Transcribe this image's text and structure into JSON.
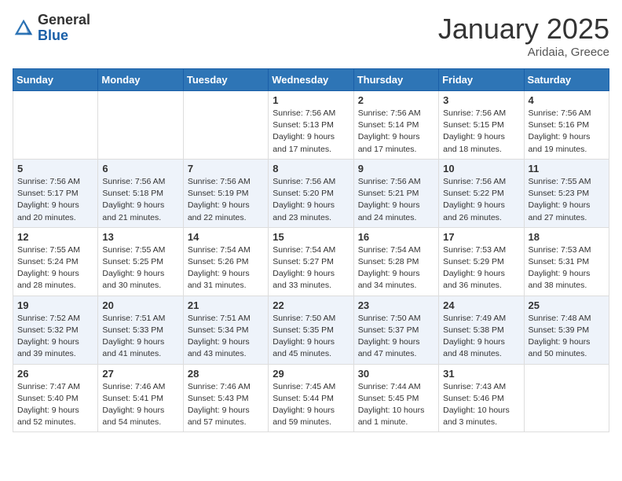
{
  "header": {
    "logo_general": "General",
    "logo_blue": "Blue",
    "month": "January 2025",
    "location": "Aridaia, Greece"
  },
  "weekdays": [
    "Sunday",
    "Monday",
    "Tuesday",
    "Wednesday",
    "Thursday",
    "Friday",
    "Saturday"
  ],
  "weeks": [
    [
      {
        "day": "",
        "sunrise": "",
        "sunset": "",
        "daylight": ""
      },
      {
        "day": "",
        "sunrise": "",
        "sunset": "",
        "daylight": ""
      },
      {
        "day": "",
        "sunrise": "",
        "sunset": "",
        "daylight": ""
      },
      {
        "day": "1",
        "sunrise": "Sunrise: 7:56 AM",
        "sunset": "Sunset: 5:13 PM",
        "daylight": "Daylight: 9 hours and 17 minutes."
      },
      {
        "day": "2",
        "sunrise": "Sunrise: 7:56 AM",
        "sunset": "Sunset: 5:14 PM",
        "daylight": "Daylight: 9 hours and 17 minutes."
      },
      {
        "day": "3",
        "sunrise": "Sunrise: 7:56 AM",
        "sunset": "Sunset: 5:15 PM",
        "daylight": "Daylight: 9 hours and 18 minutes."
      },
      {
        "day": "4",
        "sunrise": "Sunrise: 7:56 AM",
        "sunset": "Sunset: 5:16 PM",
        "daylight": "Daylight: 9 hours and 19 minutes."
      }
    ],
    [
      {
        "day": "5",
        "sunrise": "Sunrise: 7:56 AM",
        "sunset": "Sunset: 5:17 PM",
        "daylight": "Daylight: 9 hours and 20 minutes."
      },
      {
        "day": "6",
        "sunrise": "Sunrise: 7:56 AM",
        "sunset": "Sunset: 5:18 PM",
        "daylight": "Daylight: 9 hours and 21 minutes."
      },
      {
        "day": "7",
        "sunrise": "Sunrise: 7:56 AM",
        "sunset": "Sunset: 5:19 PM",
        "daylight": "Daylight: 9 hours and 22 minutes."
      },
      {
        "day": "8",
        "sunrise": "Sunrise: 7:56 AM",
        "sunset": "Sunset: 5:20 PM",
        "daylight": "Daylight: 9 hours and 23 minutes."
      },
      {
        "day": "9",
        "sunrise": "Sunrise: 7:56 AM",
        "sunset": "Sunset: 5:21 PM",
        "daylight": "Daylight: 9 hours and 24 minutes."
      },
      {
        "day": "10",
        "sunrise": "Sunrise: 7:56 AM",
        "sunset": "Sunset: 5:22 PM",
        "daylight": "Daylight: 9 hours and 26 minutes."
      },
      {
        "day": "11",
        "sunrise": "Sunrise: 7:55 AM",
        "sunset": "Sunset: 5:23 PM",
        "daylight": "Daylight: 9 hours and 27 minutes."
      }
    ],
    [
      {
        "day": "12",
        "sunrise": "Sunrise: 7:55 AM",
        "sunset": "Sunset: 5:24 PM",
        "daylight": "Daylight: 9 hours and 28 minutes."
      },
      {
        "day": "13",
        "sunrise": "Sunrise: 7:55 AM",
        "sunset": "Sunset: 5:25 PM",
        "daylight": "Daylight: 9 hours and 30 minutes."
      },
      {
        "day": "14",
        "sunrise": "Sunrise: 7:54 AM",
        "sunset": "Sunset: 5:26 PM",
        "daylight": "Daylight: 9 hours and 31 minutes."
      },
      {
        "day": "15",
        "sunrise": "Sunrise: 7:54 AM",
        "sunset": "Sunset: 5:27 PM",
        "daylight": "Daylight: 9 hours and 33 minutes."
      },
      {
        "day": "16",
        "sunrise": "Sunrise: 7:54 AM",
        "sunset": "Sunset: 5:28 PM",
        "daylight": "Daylight: 9 hours and 34 minutes."
      },
      {
        "day": "17",
        "sunrise": "Sunrise: 7:53 AM",
        "sunset": "Sunset: 5:29 PM",
        "daylight": "Daylight: 9 hours and 36 minutes."
      },
      {
        "day": "18",
        "sunrise": "Sunrise: 7:53 AM",
        "sunset": "Sunset: 5:31 PM",
        "daylight": "Daylight: 9 hours and 38 minutes."
      }
    ],
    [
      {
        "day": "19",
        "sunrise": "Sunrise: 7:52 AM",
        "sunset": "Sunset: 5:32 PM",
        "daylight": "Daylight: 9 hours and 39 minutes."
      },
      {
        "day": "20",
        "sunrise": "Sunrise: 7:51 AM",
        "sunset": "Sunset: 5:33 PM",
        "daylight": "Daylight: 9 hours and 41 minutes."
      },
      {
        "day": "21",
        "sunrise": "Sunrise: 7:51 AM",
        "sunset": "Sunset: 5:34 PM",
        "daylight": "Daylight: 9 hours and 43 minutes."
      },
      {
        "day": "22",
        "sunrise": "Sunrise: 7:50 AM",
        "sunset": "Sunset: 5:35 PM",
        "daylight": "Daylight: 9 hours and 45 minutes."
      },
      {
        "day": "23",
        "sunrise": "Sunrise: 7:50 AM",
        "sunset": "Sunset: 5:37 PM",
        "daylight": "Daylight: 9 hours and 47 minutes."
      },
      {
        "day": "24",
        "sunrise": "Sunrise: 7:49 AM",
        "sunset": "Sunset: 5:38 PM",
        "daylight": "Daylight: 9 hours and 48 minutes."
      },
      {
        "day": "25",
        "sunrise": "Sunrise: 7:48 AM",
        "sunset": "Sunset: 5:39 PM",
        "daylight": "Daylight: 9 hours and 50 minutes."
      }
    ],
    [
      {
        "day": "26",
        "sunrise": "Sunrise: 7:47 AM",
        "sunset": "Sunset: 5:40 PM",
        "daylight": "Daylight: 9 hours and 52 minutes."
      },
      {
        "day": "27",
        "sunrise": "Sunrise: 7:46 AM",
        "sunset": "Sunset: 5:41 PM",
        "daylight": "Daylight: 9 hours and 54 minutes."
      },
      {
        "day": "28",
        "sunrise": "Sunrise: 7:46 AM",
        "sunset": "Sunset: 5:43 PM",
        "daylight": "Daylight: 9 hours and 57 minutes."
      },
      {
        "day": "29",
        "sunrise": "Sunrise: 7:45 AM",
        "sunset": "Sunset: 5:44 PM",
        "daylight": "Daylight: 9 hours and 59 minutes."
      },
      {
        "day": "30",
        "sunrise": "Sunrise: 7:44 AM",
        "sunset": "Sunset: 5:45 PM",
        "daylight": "Daylight: 10 hours and 1 minute."
      },
      {
        "day": "31",
        "sunrise": "Sunrise: 7:43 AM",
        "sunset": "Sunset: 5:46 PM",
        "daylight": "Daylight: 10 hours and 3 minutes."
      },
      {
        "day": "",
        "sunrise": "",
        "sunset": "",
        "daylight": ""
      }
    ]
  ]
}
